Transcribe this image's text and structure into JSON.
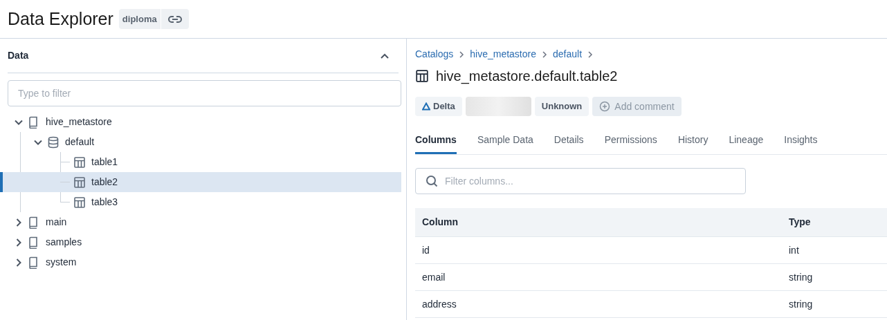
{
  "header": {
    "title": "Data Explorer",
    "workspace": "diploma"
  },
  "data_panel": {
    "title": "Data",
    "expanded": true,
    "filter": {
      "placeholder": "Type to filter"
    },
    "tree": [
      {
        "label": "hive_metastore",
        "kind": "catalog",
        "expanded": true,
        "selected": false,
        "children": [
          {
            "label": "default",
            "kind": "schema",
            "expanded": true,
            "selected": false,
            "children": [
              {
                "label": "table1",
                "kind": "table",
                "selected": false
              },
              {
                "label": "table2",
                "kind": "table",
                "selected": true
              },
              {
                "label": "table3",
                "kind": "table",
                "selected": false
              }
            ]
          }
        ]
      },
      {
        "label": "main",
        "kind": "catalog",
        "expanded": false,
        "selected": false
      },
      {
        "label": "samples",
        "kind": "catalog",
        "expanded": false,
        "selected": false
      },
      {
        "label": "system",
        "kind": "catalog",
        "expanded": false,
        "selected": false
      }
    ]
  },
  "detail": {
    "breadcrumbs": [
      "Catalogs",
      "hive_metastore",
      "default"
    ],
    "title": "hive_metastore.default.table2",
    "tags": [
      {
        "kind": "delta",
        "label": "Delta"
      },
      {
        "kind": "blurred"
      },
      {
        "kind": "plain",
        "label": "Unknown"
      },
      {
        "kind": "action",
        "label": "Add comment",
        "disabled": true
      }
    ],
    "tabs": [
      {
        "label": "Columns",
        "selected": true
      },
      {
        "label": "Sample Data",
        "selected": false
      },
      {
        "label": "Details",
        "selected": false
      },
      {
        "label": "Permissions",
        "selected": false
      },
      {
        "label": "History",
        "selected": false
      },
      {
        "label": "Lineage",
        "selected": false
      },
      {
        "label": "Insights",
        "selected": false
      }
    ],
    "column_filter": {
      "placeholder": "Filter columns..."
    },
    "table": {
      "columns": [
        "Column",
        "Type"
      ],
      "rows": [
        [
          "id",
          "int"
        ],
        [
          "email",
          "string"
        ],
        [
          "address",
          "string"
        ]
      ]
    }
  }
}
